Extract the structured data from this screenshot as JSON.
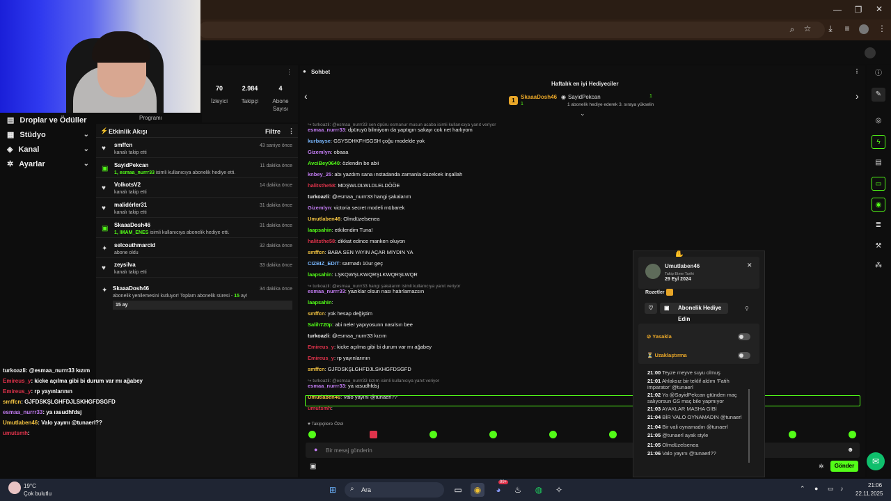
{
  "stats": [
    {
      "value": "70",
      "label": "İzleyici"
    },
    {
      "value": "2.984",
      "label": "Takipçi"
    },
    {
      "value": "4",
      "label": "Abone Sayısı"
    }
  ],
  "program_label": "Programı",
  "leftnav": [
    {
      "label": "Droplar ve Ödüller",
      "icon": "gift-icon"
    },
    {
      "label": "Stüdyo",
      "icon": "grid-icon"
    },
    {
      "label": "Kanal",
      "icon": "layers-icon"
    },
    {
      "label": "Ayarlar",
      "icon": "gear-icon"
    }
  ],
  "feed": {
    "title": "Etkinlik Akışı",
    "filter": "Filtre",
    "items": [
      {
        "name": "smffcn",
        "sub": "kanalı takip etti",
        "time": "43 saniye önce",
        "icon": "heart-icon",
        "g": ""
      },
      {
        "name": "SayidPekcan",
        "g": "1, esmaa_nurrr33",
        "sub": " isimli kullanıcıya abonelik hediye etti.",
        "time": "11 dakika önce",
        "icon": "gift-icon"
      },
      {
        "name": "VolkotsV2",
        "sub": "kanalı takip etti",
        "time": "14 dakika önce",
        "icon": "heart-icon",
        "g": ""
      },
      {
        "name": "malidérler31",
        "sub": "kanalı takip etti",
        "time": "31 dakika önce",
        "icon": "heart-icon",
        "g": ""
      },
      {
        "name": "SkaaaDosh46",
        "g": "1, IMAM_ENES",
        "sub": " isimli kullanıcıya abonelik hediye etti.",
        "time": "31 dakika önce",
        "icon": "gift-icon"
      },
      {
        "name": "selcouthmarcid",
        "sub": "abone oldu",
        "time": "32 dakika önce",
        "icon": "star-icon",
        "g": ""
      },
      {
        "name": "zeysilva",
        "sub": "kanalı takip etti",
        "time": "33 dakika önce",
        "icon": "heart-icon",
        "g": ""
      }
    ],
    "last": {
      "name": "SkaaaDosh46",
      "sub": "abonelik yenilemesini kutluyor! Toplam abonelik süresi -",
      "months": "15",
      "sub2": "ay!",
      "time": "34 dakika önce",
      "badge": "15 ay"
    }
  },
  "overlay": [
    {
      "u": "turkoazli",
      "t": ": @esmaa_nurrr33 kızım",
      "c": "#f0f0f0"
    },
    {
      "u": "Emireus_y",
      "t": ": kicke açılma gibi bi durum var mı ağabey",
      "c": "#e0334b"
    },
    {
      "u": "Emireus_y",
      "t": ": rp yayınlarının",
      "c": "#e0334b"
    },
    {
      "u": "smffcn",
      "t": ": GJFDSKŞLGHFDJLSKHGFDSGFD",
      "c": "#f5c542"
    },
    {
      "u": "esmaa_nurrr33",
      "t": ": ya ıasudhfdsj",
      "c": "#c27cf2"
    },
    {
      "u": "Umutlaben46",
      "t": ": Valo yayını @tunaerl??",
      "c": "#f5c542"
    },
    {
      "u": "umutsmh",
      "t": ":",
      "c": "#e0334b"
    }
  ],
  "chat": {
    "title": "Sohbet",
    "gifters_title": "Haftalık en iyi Hediyeciler",
    "top1": "SkaaaDosh46",
    "top1_count": "1",
    "top2": "SayidPekcan",
    "top2_count": "1",
    "top2_note": "1 abonelik hediye ederek 3. sıraya yükselin",
    "lines": [
      {
        "reply": "turkoazli: @esmaa_nurrr33 sen dpüru esmanur musun acaba isimli kullanıcıya yanıt veriyor"
      },
      {
        "u": "esmaa_nurrr33",
        "c": "#c27cf2",
        "t": ": dpüruyü bilmiyom da yaptıgın sakayı cok net harlıyom"
      },
      {
        "u": "kurbayse",
        "c": "#79b8ff",
        "t": ": GSYSDHKFHSGSH çoğu modelde yok"
      },
      {
        "u": "Gizemlyn",
        "c": "#c27cf2",
        "t": ": obaaa"
      },
      {
        "u": "AvciBey0640",
        "c": "#53fc18",
        "t": ": özlendin be abii"
      },
      {
        "u": "knbey_25",
        "c": "#c27cf2",
        "t": ": abı yazdım sana ınstadanda zamanla duzelcek inşallah"
      },
      {
        "u": "halitsthe58",
        "c": "#e0334b",
        "t": ": MDŞWLDLWLDLELDÖÖE"
      },
      {
        "u": "turkoazli",
        "c": "#f0f0f0",
        "t": ": @esmaa_nurrr33 hangi şakalarım"
      },
      {
        "u": "Gizemlyn",
        "c": "#c27cf2",
        "t": ": victoria secret modeli mübarek"
      },
      {
        "u": "Umutlaben46",
        "c": "#f5c542",
        "t": ": Olmdüzelsenea"
      },
      {
        "u": "laapsahin",
        "c": "#53fc18",
        "t": ": etkilendim Tuna!"
      },
      {
        "u": "halitsthe58",
        "c": "#e0334b",
        "t": ": dikkat edince manken oluyon"
      },
      {
        "u": "smffcn",
        "c": "#f5c542",
        "t": ": BABA SEN YAYIN AÇAR MIYDIN YA"
      },
      {
        "u": "CIZBIZ_EDIT",
        "c": "#79b8ff",
        "t": ": sarmadı 10ur geç"
      },
      {
        "u": "laapsahin",
        "c": "#53fc18",
        "t": ": LŞKQWŞLKWQRŞLKWQRŞLWQR"
      },
      {
        "reply": "turkoazli: @esmaa_nurrr33 hangi şakalarım isimli kullanıcıya yanıt veriyor"
      },
      {
        "u": "esmaa_nurrr33",
        "c": "#c27cf2",
        "t": ": yazıklar olsun nası hatırlamazsın"
      },
      {
        "u": "laapsahin",
        "c": "#53fc18",
        "t": ":"
      },
      {
        "u": "smffcn",
        "c": "#f5c542",
        "t": ": yok hesap değiştim"
      },
      {
        "u": "Salih720p",
        "c": "#53fc18",
        "t": ": abi neler yapıyosunn nasılsın bee"
      },
      {
        "u": "turkoazli",
        "c": "#f0f0f0",
        "t": ": @esmaa_nurrr33 kızım"
      },
      {
        "u": "Emireus_y",
        "c": "#e0334b",
        "t": ": kicke açılma gibi bi durum var mı ağabey"
      },
      {
        "u": "Emireus_y",
        "c": "#e0334b",
        "t": ": rp yayınlarının"
      },
      {
        "u": "smffcn",
        "c": "#f5c542",
        "t": ": GJFDSKŞLGHFDJLSKHGFDSGFD"
      },
      {
        "reply": "turkoazli: @esmaa_nurrr33 kızım isimli kullanıcıya yanıt veriyor"
      },
      {
        "u": "esmaa_nurrr33",
        "c": "#c27cf2",
        "t": ": ya ıasudhfdsj"
      },
      {
        "u": "Umutlaben46",
        "c": "#f5c542",
        "t": ": Valo yayını @tunaerl??"
      },
      {
        "u": "umutsmh",
        "c": "#e0334b",
        "t": ":"
      }
    ],
    "followers_only": "Takipçilere Özel",
    "input_placeholder": "Bir mesaj gönderin",
    "send": "Gönder"
  },
  "popup": {
    "username": "Umutlaben46",
    "follow_label": "Takip Etme Tarihi",
    "follow_date": "29 Eyl 2024",
    "badges": "Rozetler",
    "gift_btn": "Abonelik Hediye Edin",
    "ban": "Yasakla",
    "timeout": "Uzaklaştırma",
    "history": [
      {
        "t": "21:00",
        "m": "Teyze meyve suyu olmuş"
      },
      {
        "t": "21:01",
        "m": "Ahlaksız bir teklif aldım 'Fatih imparator' @tunaerl"
      },
      {
        "t": "21:02",
        "m": "Ya @SayidPekcan gtünden maç salıyorsun GS maç bile yapmıyor"
      },
      {
        "t": "21:03",
        "m": "AYAKLAR MASHA GİBİ"
      },
      {
        "t": "21:04",
        "m": "BİR VALO OYNAMADIN @tunaerl"
      },
      {
        "t": "21:04",
        "m": "Bir vali oynamadın @tunaerl"
      },
      {
        "t": "21:05",
        "m": "@tunaerl ayak style"
      },
      {
        "t": "21:05",
        "m": "Olmdüzelsenea"
      },
      {
        "t": "21:06",
        "m": "Valo yayını @tunaerl??"
      }
    ]
  },
  "taskbar": {
    "weather_temp": "19°C",
    "weather_desc": "Çok bulutlu",
    "search": "Ara",
    "time": "21:06",
    "date": "22.11.2025",
    "notif_badge": "99+"
  },
  "colors": {
    "accent": "#53fc18",
    "bg": "#0f0f0f"
  }
}
